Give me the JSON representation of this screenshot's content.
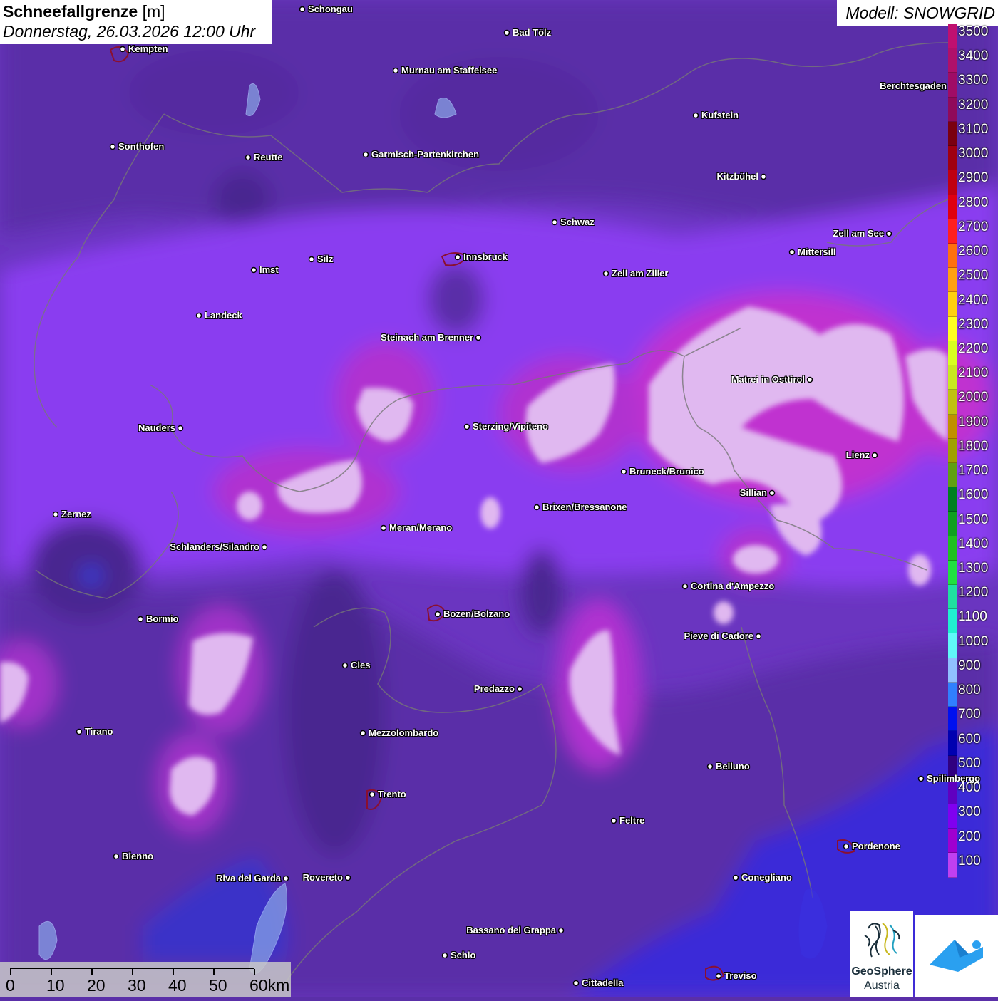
{
  "header": {
    "title_bold": "Schneefallgrenze",
    "title_unit": "[m]",
    "datetime": "Donnerstag, 26.03.2026 12:00 Uhr",
    "model": "Modell: SNOWGRID"
  },
  "legend": {
    "labels": [
      "3500",
      "3400",
      "3300",
      "3200",
      "3100",
      "3000",
      "2900",
      "2800",
      "2700",
      "2600",
      "2500",
      "2400",
      "2300",
      "2200",
      "2100",
      "2000",
      "1900",
      "1800",
      "1700",
      "1600",
      "1500",
      "1400",
      "1300",
      "1200",
      "1100",
      "1000",
      "900",
      "800",
      "700",
      "600",
      "500",
      "400",
      "300",
      "200",
      "100"
    ],
    "colors": [
      "#c01070",
      "#b0106a",
      "#a00c66",
      "#900a5a",
      "#7a0010",
      "#a00010",
      "#c00010",
      "#e00010",
      "#ff2020",
      "#ff7010",
      "#ffa010",
      "#ffd010",
      "#ffff20",
      "#d8ff20",
      "#c8e820",
      "#c0c010",
      "#c09000",
      "#a0a000",
      "#60a010",
      "#008020",
      "#10a020",
      "#20c020",
      "#20e040",
      "#20e0a0",
      "#20f0d0",
      "#60f8f8",
      "#90c0ff",
      "#3080ff",
      "#0010f0",
      "#0000b0",
      "#300080",
      "#6000c0",
      "#8000f0",
      "#a000d0",
      "#c040f0"
    ]
  },
  "cities": [
    {
      "name": "Schongau",
      "label_side": "right"
    },
    {
      "name": "Bad Tölz",
      "label_side": "right"
    },
    {
      "name": "Kempten",
      "label_side": "right"
    },
    {
      "name": "Murnau am Staffelsee",
      "label_side": "right"
    },
    {
      "name": "Berchtesgaden",
      "label_side": "left"
    },
    {
      "name": "Kufstein",
      "label_side": "right"
    },
    {
      "name": "Sonthofen",
      "label_side": "right"
    },
    {
      "name": "Reutte",
      "label_side": "right"
    },
    {
      "name": "Garmisch-Partenkirchen",
      "label_side": "right"
    },
    {
      "name": "Kitzbühel",
      "label_side": "left"
    },
    {
      "name": "Schwaz",
      "label_side": "right"
    },
    {
      "name": "Zell am See",
      "label_side": "left"
    },
    {
      "name": "Innsbruck",
      "label_side": "right"
    },
    {
      "name": "Mittersill",
      "label_side": "right"
    },
    {
      "name": "Imst",
      "label_side": "right"
    },
    {
      "name": "Silz",
      "label_side": "right"
    },
    {
      "name": "Zell am Ziller",
      "label_side": "right"
    },
    {
      "name": "Landeck",
      "label_side": "right"
    },
    {
      "name": "Steinach am Brenner",
      "label_side": "left"
    },
    {
      "name": "Matrei in Osttirol",
      "label_side": "left"
    },
    {
      "name": "Nauders",
      "label_side": "left"
    },
    {
      "name": "Sterzing/Vipiteno",
      "label_side": "right"
    },
    {
      "name": "Lienz",
      "label_side": "left"
    },
    {
      "name": "Bruneck/Brunico",
      "label_side": "right"
    },
    {
      "name": "Sillian",
      "label_side": "left"
    },
    {
      "name": "Zernez",
      "label_side": "right"
    },
    {
      "name": "Brixen/Bressanone",
      "label_side": "right"
    },
    {
      "name": "Meran/Merano",
      "label_side": "right"
    },
    {
      "name": "Schlanders/Silandro",
      "label_side": "left"
    },
    {
      "name": "Cortina d'Ampezzo",
      "label_side": "right"
    },
    {
      "name": "Bozen/Bolzano",
      "label_side": "right"
    },
    {
      "name": "Bormio",
      "label_side": "right"
    },
    {
      "name": "Pieve di Cadore",
      "label_side": "left"
    },
    {
      "name": "Cles",
      "label_side": "right"
    },
    {
      "name": "Predazzo",
      "label_side": "left"
    },
    {
      "name": "Tirano",
      "label_side": "right"
    },
    {
      "name": "Mezzolombardo",
      "label_side": "right"
    },
    {
      "name": "Belluno",
      "label_side": "right"
    },
    {
      "name": "Spilimbergo",
      "label_side": "right"
    },
    {
      "name": "Trento",
      "label_side": "right"
    },
    {
      "name": "Feltre",
      "label_side": "right"
    },
    {
      "name": "Pordenone",
      "label_side": "right"
    },
    {
      "name": "Bienno",
      "label_side": "right"
    },
    {
      "name": "Riva del Garda",
      "label_side": "left"
    },
    {
      "name": "Rovereto",
      "label_side": "left"
    },
    {
      "name": "Conegliano",
      "label_side": "right"
    },
    {
      "name": "Bassano del Grappa",
      "label_side": "left"
    },
    {
      "name": "Schio",
      "label_side": "right"
    },
    {
      "name": "Treviso",
      "label_side": "right"
    },
    {
      "name": "Cittadella",
      "label_side": "right"
    }
  ],
  "scalebar": {
    "labels": [
      "0",
      "10",
      "20",
      "30",
      "40",
      "50",
      "60km"
    ]
  },
  "logos": {
    "geosphere_name": "GeoSphere",
    "geosphere_sub": "Austria"
  }
}
